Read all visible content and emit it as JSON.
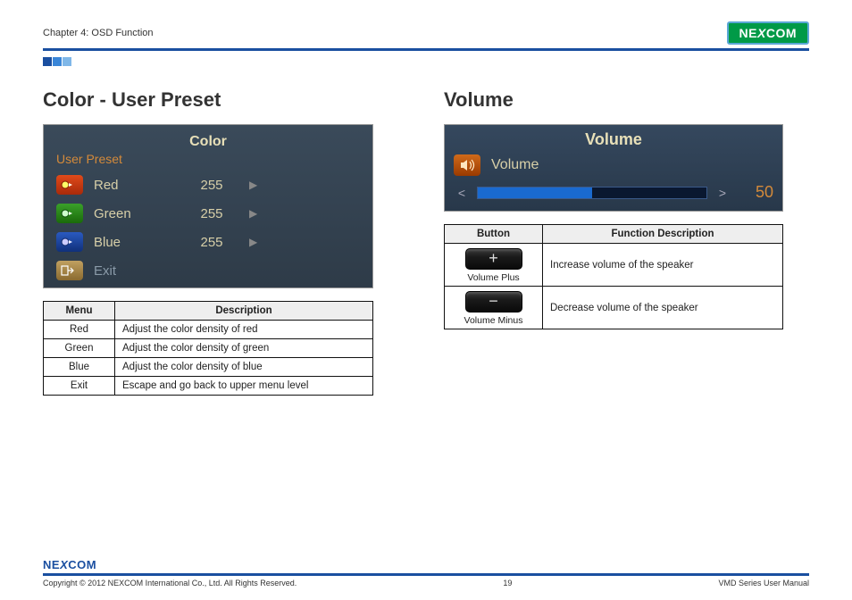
{
  "header": {
    "chapter": "Chapter 4: OSD Function",
    "brand": "NEXCOM"
  },
  "left": {
    "title": "Color - User Preset",
    "osd": {
      "heading": "Color",
      "subheading": "User Preset",
      "items": [
        {
          "label": "Red",
          "value": "255"
        },
        {
          "label": "Green",
          "value": "255"
        },
        {
          "label": "Blue",
          "value": "255"
        }
      ],
      "exit": "Exit"
    },
    "table": {
      "col1": "Menu",
      "col2": "Description",
      "rows": [
        {
          "menu": "Red",
          "desc": "Adjust the color density of red"
        },
        {
          "menu": "Green",
          "desc": "Adjust the color density of green"
        },
        {
          "menu": "Blue",
          "desc": "Adjust the color density of blue"
        },
        {
          "menu": "Exit",
          "desc": "Escape and go back to upper menu level"
        }
      ]
    }
  },
  "right": {
    "title": "Volume",
    "osd": {
      "heading": "Volume",
      "label": "Volume",
      "value": "50",
      "percent": 50
    },
    "table": {
      "col1": "Button",
      "col2": "Function Description",
      "rows": [
        {
          "symbol": "+",
          "caption": "Volume Plus",
          "desc": "Increase volume of the speaker"
        },
        {
          "symbol": "−",
          "caption": "Volume Minus",
          "desc": "Decrease volume of the speaker"
        }
      ]
    }
  },
  "footer": {
    "brand": "NEXCOM",
    "copyright": "Copyright © 2012 NEXCOM International Co., Ltd. All Rights Reserved.",
    "page": "19",
    "doc": "VMD Series User Manual"
  }
}
